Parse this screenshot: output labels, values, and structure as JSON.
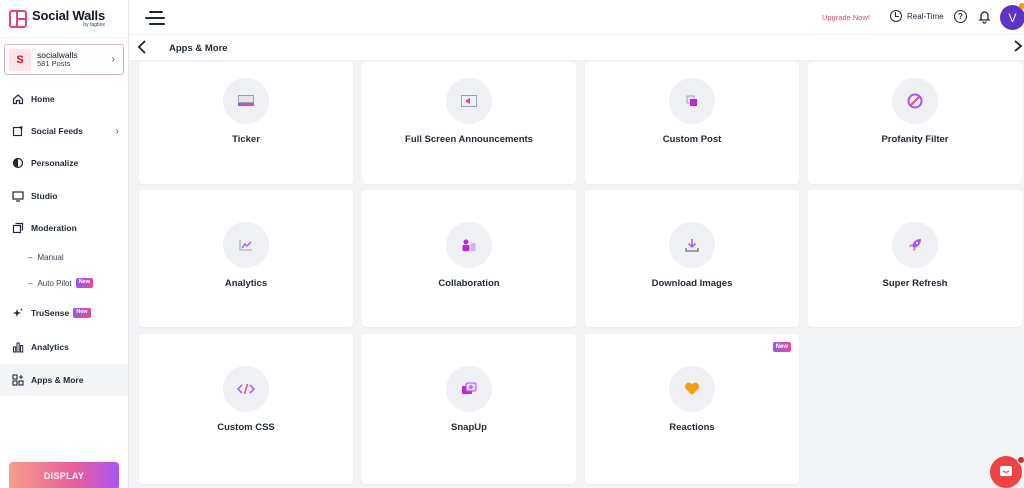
{
  "brand": {
    "name": "Social Walls",
    "by": "by tagbox"
  },
  "account": {
    "initial": "S",
    "name": "socialwalls",
    "posts": "581 Posts"
  },
  "sidebar": {
    "items": [
      {
        "label": "Home",
        "icon": "home-icon"
      },
      {
        "label": "Social Feeds",
        "icon": "social-feeds-icon"
      },
      {
        "label": "Personalize",
        "icon": "personalize-icon"
      },
      {
        "label": "Studio",
        "icon": "monitor-icon"
      },
      {
        "label": "Moderation",
        "icon": "moderation-icon"
      },
      {
        "label": "TruSense",
        "icon": "sparkle-icon",
        "badge": "New"
      },
      {
        "label": "Analytics",
        "icon": "bar-chart-icon"
      },
      {
        "label": "Apps & More",
        "icon": "apps-icon",
        "active": true
      }
    ],
    "moderation_sub": [
      {
        "label": "Manual"
      },
      {
        "label": "Auto Pilot",
        "badge": "New"
      }
    ],
    "display_button": "DISPLAY"
  },
  "topbar": {
    "upgrade": "Upgrade Now!",
    "realtime": "Real-Time",
    "help": "?",
    "avatar": "V"
  },
  "page": {
    "title": "Apps & More"
  },
  "apps": [
    {
      "label": "Ticker",
      "icon": "ticker-icon"
    },
    {
      "label": "Full Screen Announcements",
      "icon": "announcement-icon"
    },
    {
      "label": "Custom Post",
      "icon": "custom-post-icon"
    },
    {
      "label": "Profanity Filter",
      "icon": "profanity-filter-icon"
    },
    {
      "label": "Analytics",
      "icon": "analytics-icon"
    },
    {
      "label": "Collaboration",
      "icon": "collaboration-icon"
    },
    {
      "label": "Download Images",
      "icon": "download-icon"
    },
    {
      "label": "Super Refresh",
      "icon": "rocket-icon"
    },
    {
      "label": "Custom CSS",
      "icon": "code-icon"
    },
    {
      "label": "SnapUp",
      "icon": "snapup-icon"
    },
    {
      "label": "Reactions",
      "icon": "heart-icon",
      "badge": "New"
    }
  ],
  "colors": {
    "accent": "#e0457b",
    "avatar": "#5b34c6",
    "chat": "#ef4444"
  }
}
